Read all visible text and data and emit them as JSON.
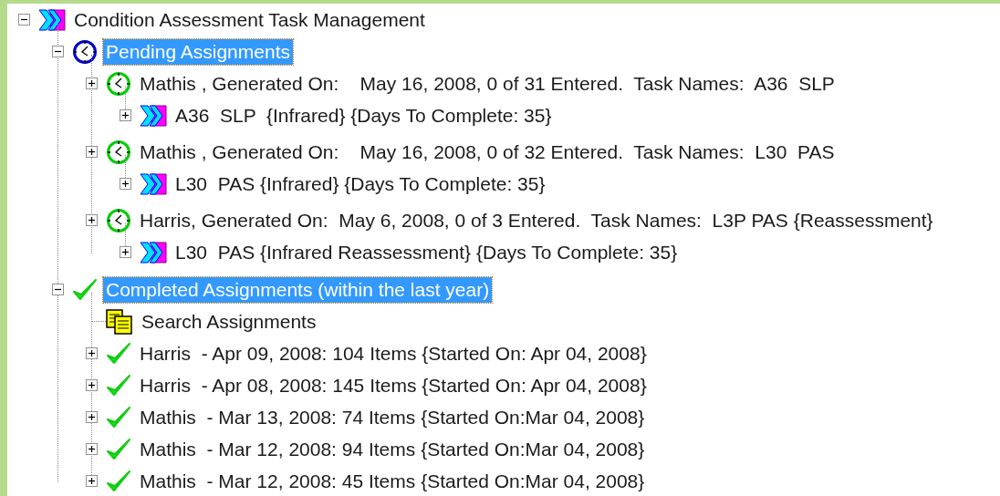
{
  "tree": [
    {
      "label": "Condition Assessment Task Management",
      "kind": "root",
      "expanded": true,
      "selected": false,
      "children": [
        {
          "label": "Pending Assignments",
          "kind": "pending-group",
          "expanded": true,
          "selected": true,
          "children": [
            {
              "label": "Mathis , Generated On:    May 16, 2008, 0 of 31 Entered.  Task Names:  A36  SLP",
              "kind": "pending",
              "expanded": false,
              "selected": false,
              "children": [
                {
                  "label": "A36  SLP  {Infrared} {Days To Complete: 35}",
                  "kind": "task",
                  "expanded": false,
                  "selected": false
                }
              ]
            },
            {
              "label": "Mathis , Generated On:    May 16, 2008, 0 of 32 Entered.  Task Names:  L30  PAS",
              "kind": "pending",
              "expanded": false,
              "selected": false,
              "children": [
                {
                  "label": "L30  PAS {Infrared} {Days To Complete: 35}",
                  "kind": "task",
                  "expanded": false,
                  "selected": false
                }
              ]
            },
            {
              "label": "Harris, Generated On:  May 6, 2008, 0 of 3 Entered.  Task Names:  L3P PAS {Reassessment}",
              "kind": "pending",
              "expanded": false,
              "selected": false,
              "children": [
                {
                  "label": "L30  PAS {Infrared Reassessment} {Days To Complete: 35}",
                  "kind": "task",
                  "expanded": false,
                  "selected": false
                }
              ]
            }
          ]
        },
        {
          "label": "Completed Assignments (within the last year)",
          "kind": "completed-group",
          "expanded": true,
          "selected": true,
          "children": [
            {
              "label": "Search Assignments",
              "kind": "search",
              "selected": false
            },
            {
              "label": "Harris  - Apr 09, 2008: 104 Items {Started On: Apr 04, 2008}",
              "kind": "completed",
              "expanded": false,
              "selected": false
            },
            {
              "label": "Harris  - Apr 08, 2008: 145 Items {Started On: Apr 04, 2008}",
              "kind": "completed",
              "expanded": false,
              "selected": false
            },
            {
              "label": "Mathis  - Mar 13, 2008: 74 Items {Started On:Mar 04, 2008}",
              "kind": "completed",
              "expanded": false,
              "selected": false
            },
            {
              "label": "Mathis  - Mar 12, 2008: 94 Items {Started On:Mar 04, 2008}",
              "kind": "completed",
              "expanded": false,
              "selected": false
            },
            {
              "label": "Mathis  - Mar 12, 2008: 45 Items {Started On:Mar 04, 2008}",
              "kind": "completed",
              "expanded": false,
              "selected": false
            }
          ]
        }
      ]
    }
  ]
}
